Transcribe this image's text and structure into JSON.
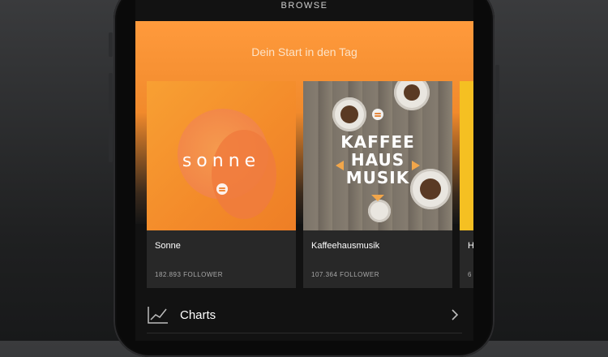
{
  "header": {
    "title": "BROWSE"
  },
  "hero": {
    "title": "Dein Start in den Tag"
  },
  "cards": [
    {
      "art_text": "sonne",
      "name": "Sonne",
      "followers": "182.893 FOLLOWER"
    },
    {
      "art_text_lines": [
        "KAFFEE",
        "HAUS",
        "MUSIK"
      ],
      "name": "Kaffeehausmusik",
      "followers": "107.364 FOLLOWER"
    },
    {
      "name": "H",
      "followers": "6"
    }
  ],
  "list": [
    {
      "label": "Charts",
      "icon": "chart-icon"
    }
  ],
  "colors": {
    "hero": "#f18a2c",
    "screen_bg": "#121212",
    "card_bg": "#282828"
  }
}
